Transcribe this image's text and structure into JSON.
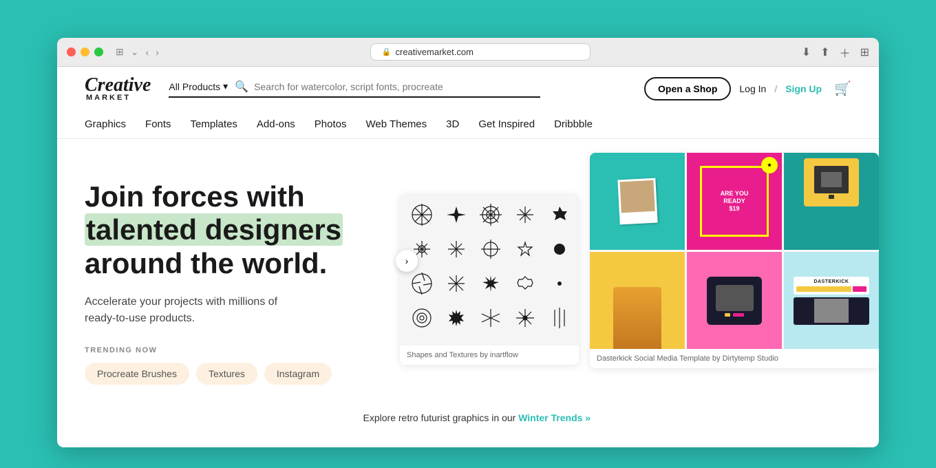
{
  "browser": {
    "url": "creativemarket.com",
    "tab_icon": "🔒"
  },
  "header": {
    "logo_creative": "Creative",
    "logo_market": "MARKET",
    "search_dropdown": "All Products",
    "search_placeholder": "Search for watercolor, script fonts, procreate",
    "btn_open_shop": "Open a Shop",
    "btn_login": "Log In",
    "btn_signup": "Sign Up",
    "divider": "/"
  },
  "nav": {
    "items": [
      {
        "label": "Graphics"
      },
      {
        "label": "Fonts"
      },
      {
        "label": "Templates"
      },
      {
        "label": "Add-ons"
      },
      {
        "label": "Photos"
      },
      {
        "label": "Web Themes"
      },
      {
        "label": "3D"
      },
      {
        "label": "Get Inspired"
      },
      {
        "label": "Dribbble"
      }
    ]
  },
  "hero": {
    "heading_line1": "Join forces with",
    "heading_line2": "talented designers",
    "heading_line3": "around the world.",
    "subtext": "Accelerate your projects with millions of\nready-to-use products.",
    "trending_label": "TRENDING NOW",
    "tags": [
      {
        "label": "Procreate Brushes"
      },
      {
        "label": "Textures"
      },
      {
        "label": "Instagram"
      }
    ]
  },
  "images": {
    "left_caption": "Shapes and Textures by inartflow",
    "right_caption": "Dasterkick Social Media Template by Dirtytemp Studio"
  },
  "bottom": {
    "text": "Explore retro futurist graphics in our",
    "link": "Winter Trends »"
  },
  "shapes": [
    "✦",
    "✼",
    "✳",
    "✦",
    "✶",
    "✳",
    "✶",
    "✦",
    "✸",
    "✴",
    "✦",
    "✶",
    "✦",
    "✳",
    "✼",
    "✦"
  ],
  "colors": {
    "accent": "#2bbfb3",
    "dark": "#1a1a1a",
    "tag_bg": "#fdf0e0"
  }
}
